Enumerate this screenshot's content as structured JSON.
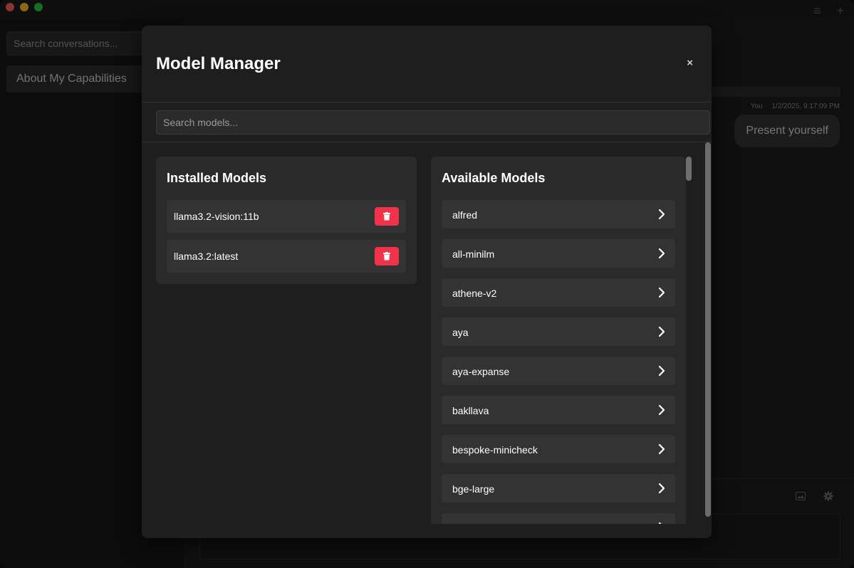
{
  "sidebar": {
    "search_placeholder": "Search conversations...",
    "conversations": [
      {
        "title": "About My Capabilities"
      }
    ]
  },
  "chat": {
    "message": {
      "sender": "You",
      "timestamp": "1/2/2025, 9:17:09 PM",
      "text": "Present yourself"
    }
  },
  "modal": {
    "title": "Model Manager",
    "close_label": "×",
    "search_placeholder": "Search models...",
    "installed": {
      "title": "Installed Models",
      "items": [
        {
          "name": "llama3.2-vision:11b"
        },
        {
          "name": "llama3.2:latest"
        }
      ]
    },
    "available": {
      "title": "Available Models",
      "items": [
        {
          "name": "alfred"
        },
        {
          "name": "all-minilm"
        },
        {
          "name": "athene-v2"
        },
        {
          "name": "aya"
        },
        {
          "name": "aya-expanse"
        },
        {
          "name": "bakllava"
        },
        {
          "name": "bespoke-minicheck"
        },
        {
          "name": "bge-large"
        },
        {
          "name": ""
        }
      ]
    }
  },
  "colors": {
    "delete_button": "#f0334a",
    "modal_background": "#1e1e1e",
    "panel_background": "#2a2a2a"
  }
}
